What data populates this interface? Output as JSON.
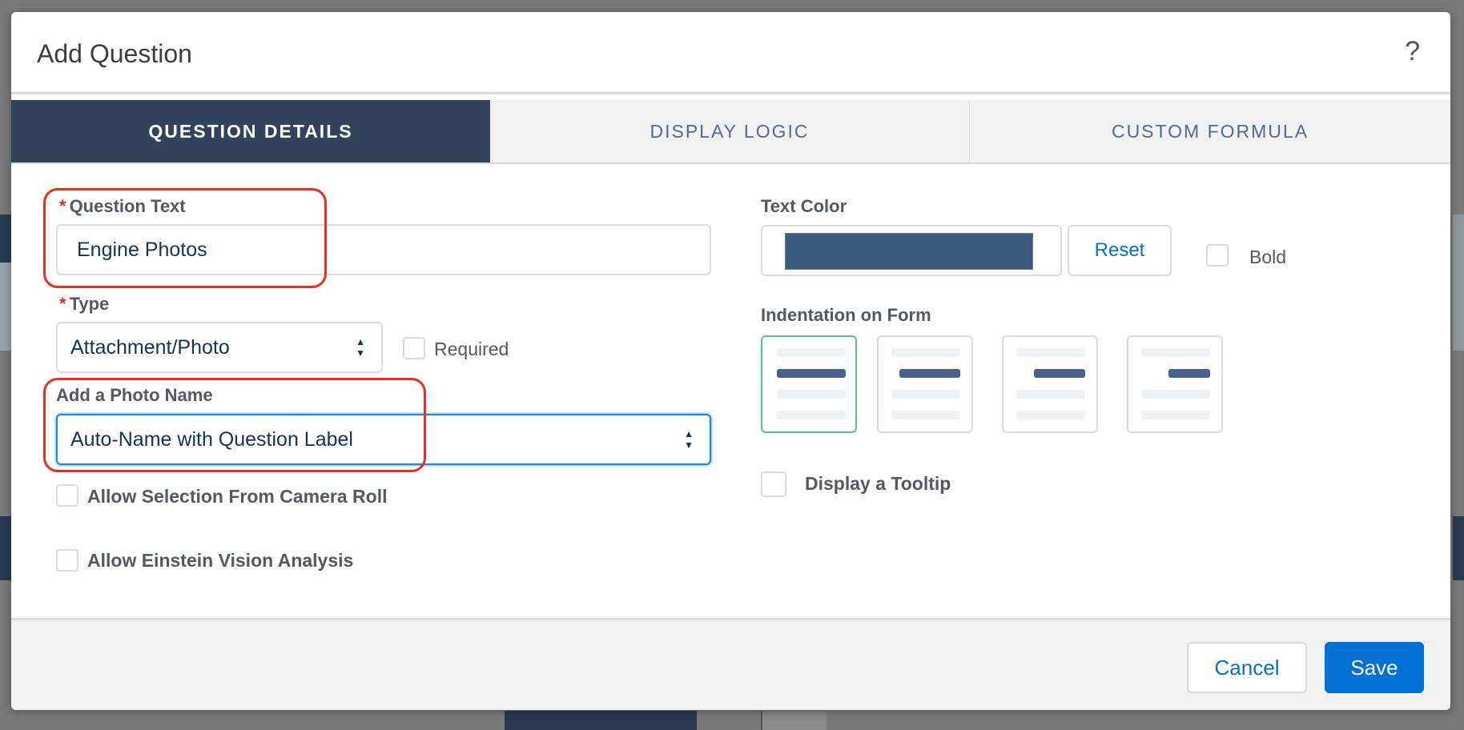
{
  "dialog": {
    "title": "Add Question",
    "help_glyph": "?"
  },
  "tabs": [
    {
      "label": "QUESTION DETAILS",
      "active": true
    },
    {
      "label": "DISPLAY LOGIC",
      "active": false
    },
    {
      "label": "CUSTOM FORMULA",
      "active": false
    }
  ],
  "left": {
    "question_text": {
      "required_mark": "*",
      "label": "Question Text",
      "value": "Engine Photos"
    },
    "type": {
      "required_mark": "*",
      "label": "Type",
      "value": "Attachment/Photo"
    },
    "required_checkbox": {
      "label": "Required",
      "checked": false
    },
    "photo_name": {
      "label": "Add a Photo Name",
      "value": "Auto-Name with Question Label"
    },
    "camera_roll": {
      "label": "Allow Selection From Camera Roll",
      "checked": false
    },
    "einstein": {
      "label": "Allow Einstein Vision Analysis",
      "checked": false
    }
  },
  "right": {
    "text_color": {
      "label": "Text Color",
      "swatch_color": "#3b5a7e",
      "reset_label": "Reset"
    },
    "bold": {
      "label": "Bold",
      "checked": false
    },
    "indentation": {
      "label": "Indentation on Form",
      "selected_index": 0,
      "options_count": 4
    },
    "tooltip": {
      "label": "Display a Tooltip",
      "checked": false
    }
  },
  "footer": {
    "cancel_label": "Cancel",
    "save_label": "Save"
  },
  "colors": {
    "accent": "#0070d2",
    "tab_active_bg": "#32435a",
    "highlight": "#e8301c",
    "selected_border": "#4bca81"
  }
}
